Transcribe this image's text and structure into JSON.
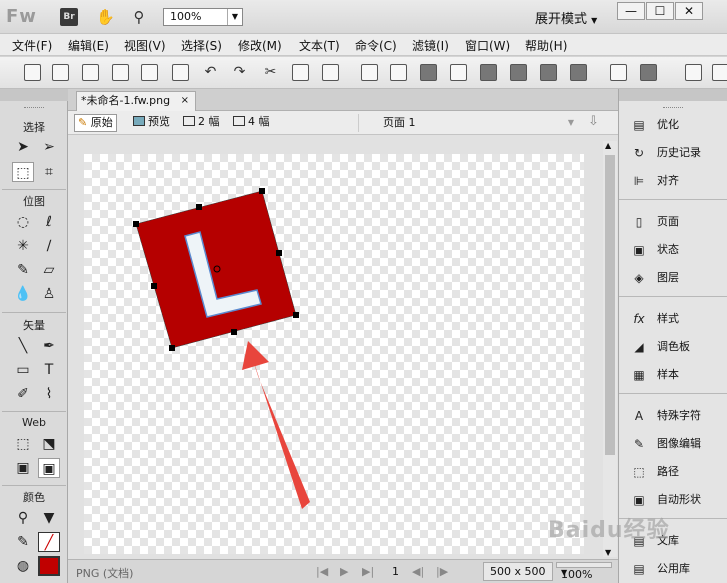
{
  "titlebar": {
    "logo": "Fw",
    "bridge": "Br",
    "zoom": "100%",
    "workspace": "展开模式",
    "min": "—",
    "max": "☐",
    "close": "✕"
  },
  "menu": [
    "文件(F)",
    "编辑(E)",
    "视图(V)",
    "选择(S)",
    "修改(M)",
    "文本(T)",
    "命令(C)",
    "滤镜(I)",
    "窗口(W)",
    "帮助(H)"
  ],
  "document": {
    "tab_title": "*未命名-1.fw.png",
    "tab_close": "×",
    "views": [
      "原始",
      "预览",
      "2 幅",
      "4 幅"
    ],
    "page": "页面 1"
  },
  "tools": {
    "sections": [
      "选择",
      "位图",
      "矢量",
      "Web",
      "颜色"
    ]
  },
  "status": {
    "format": "PNG (文档)",
    "page_num": "1",
    "size": "500 x 500",
    "zoom": "100%"
  },
  "panels": [
    "优化",
    "历史记录",
    "对齐",
    "页面",
    "状态",
    "图层",
    "样式",
    "调色板",
    "样本",
    "特殊字符",
    "图像编辑",
    "路径",
    "自动形状",
    "文库",
    "公用库"
  ],
  "colors": {
    "shape_fill": "#b50000",
    "arrow": "#e8453c",
    "fill_swatch": "#c00000"
  },
  "watermark": "Baidu经验"
}
